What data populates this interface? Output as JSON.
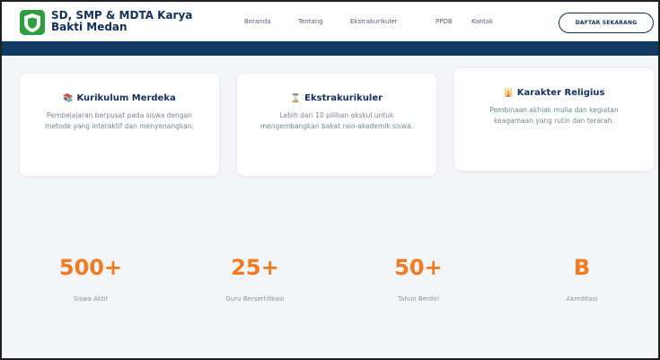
{
  "header": {
    "school_name": "SD, SMP & MDTA Karya Bakti Medan",
    "nav": [
      "Beranda",
      "Tentang",
      "Ekstrakurikuler",
      "PPDB",
      "Kontak"
    ],
    "cta_label": "DAFTAR SEKARANG"
  },
  "features": [
    {
      "icon": "book-icon",
      "title": "Kurikulum Merdeka",
      "description": "Pembelajaran berpusat pada siswa dengan metode yang interaktif dan menyenangkan."
    },
    {
      "icon": "trophy-icon",
      "title": "Ekstrakurikuler",
      "description": "Lebih dari 10 pilihan ekskul untuk mengembangkan bakat non-akademik siswa."
    },
    {
      "icon": "mosque-icon",
      "title": "Karakter Religius",
      "description": "Pembinaan akhlak mulia dan kegiatan keagamaan yang rutin dan terarah."
    }
  ],
  "stats": [
    {
      "value": "500+",
      "label": "Siswa Aktif"
    },
    {
      "value": "25+",
      "label": "Guru Bersertifikasi"
    },
    {
      "value": "50+",
      "label": "Tahun Berdiri"
    },
    {
      "value": "B",
      "label": "Akreditasi"
    }
  ],
  "colors": {
    "brand_green": "#2e9e3e",
    "navy": "#0f3a63",
    "accent_orange": "#f47a20"
  }
}
